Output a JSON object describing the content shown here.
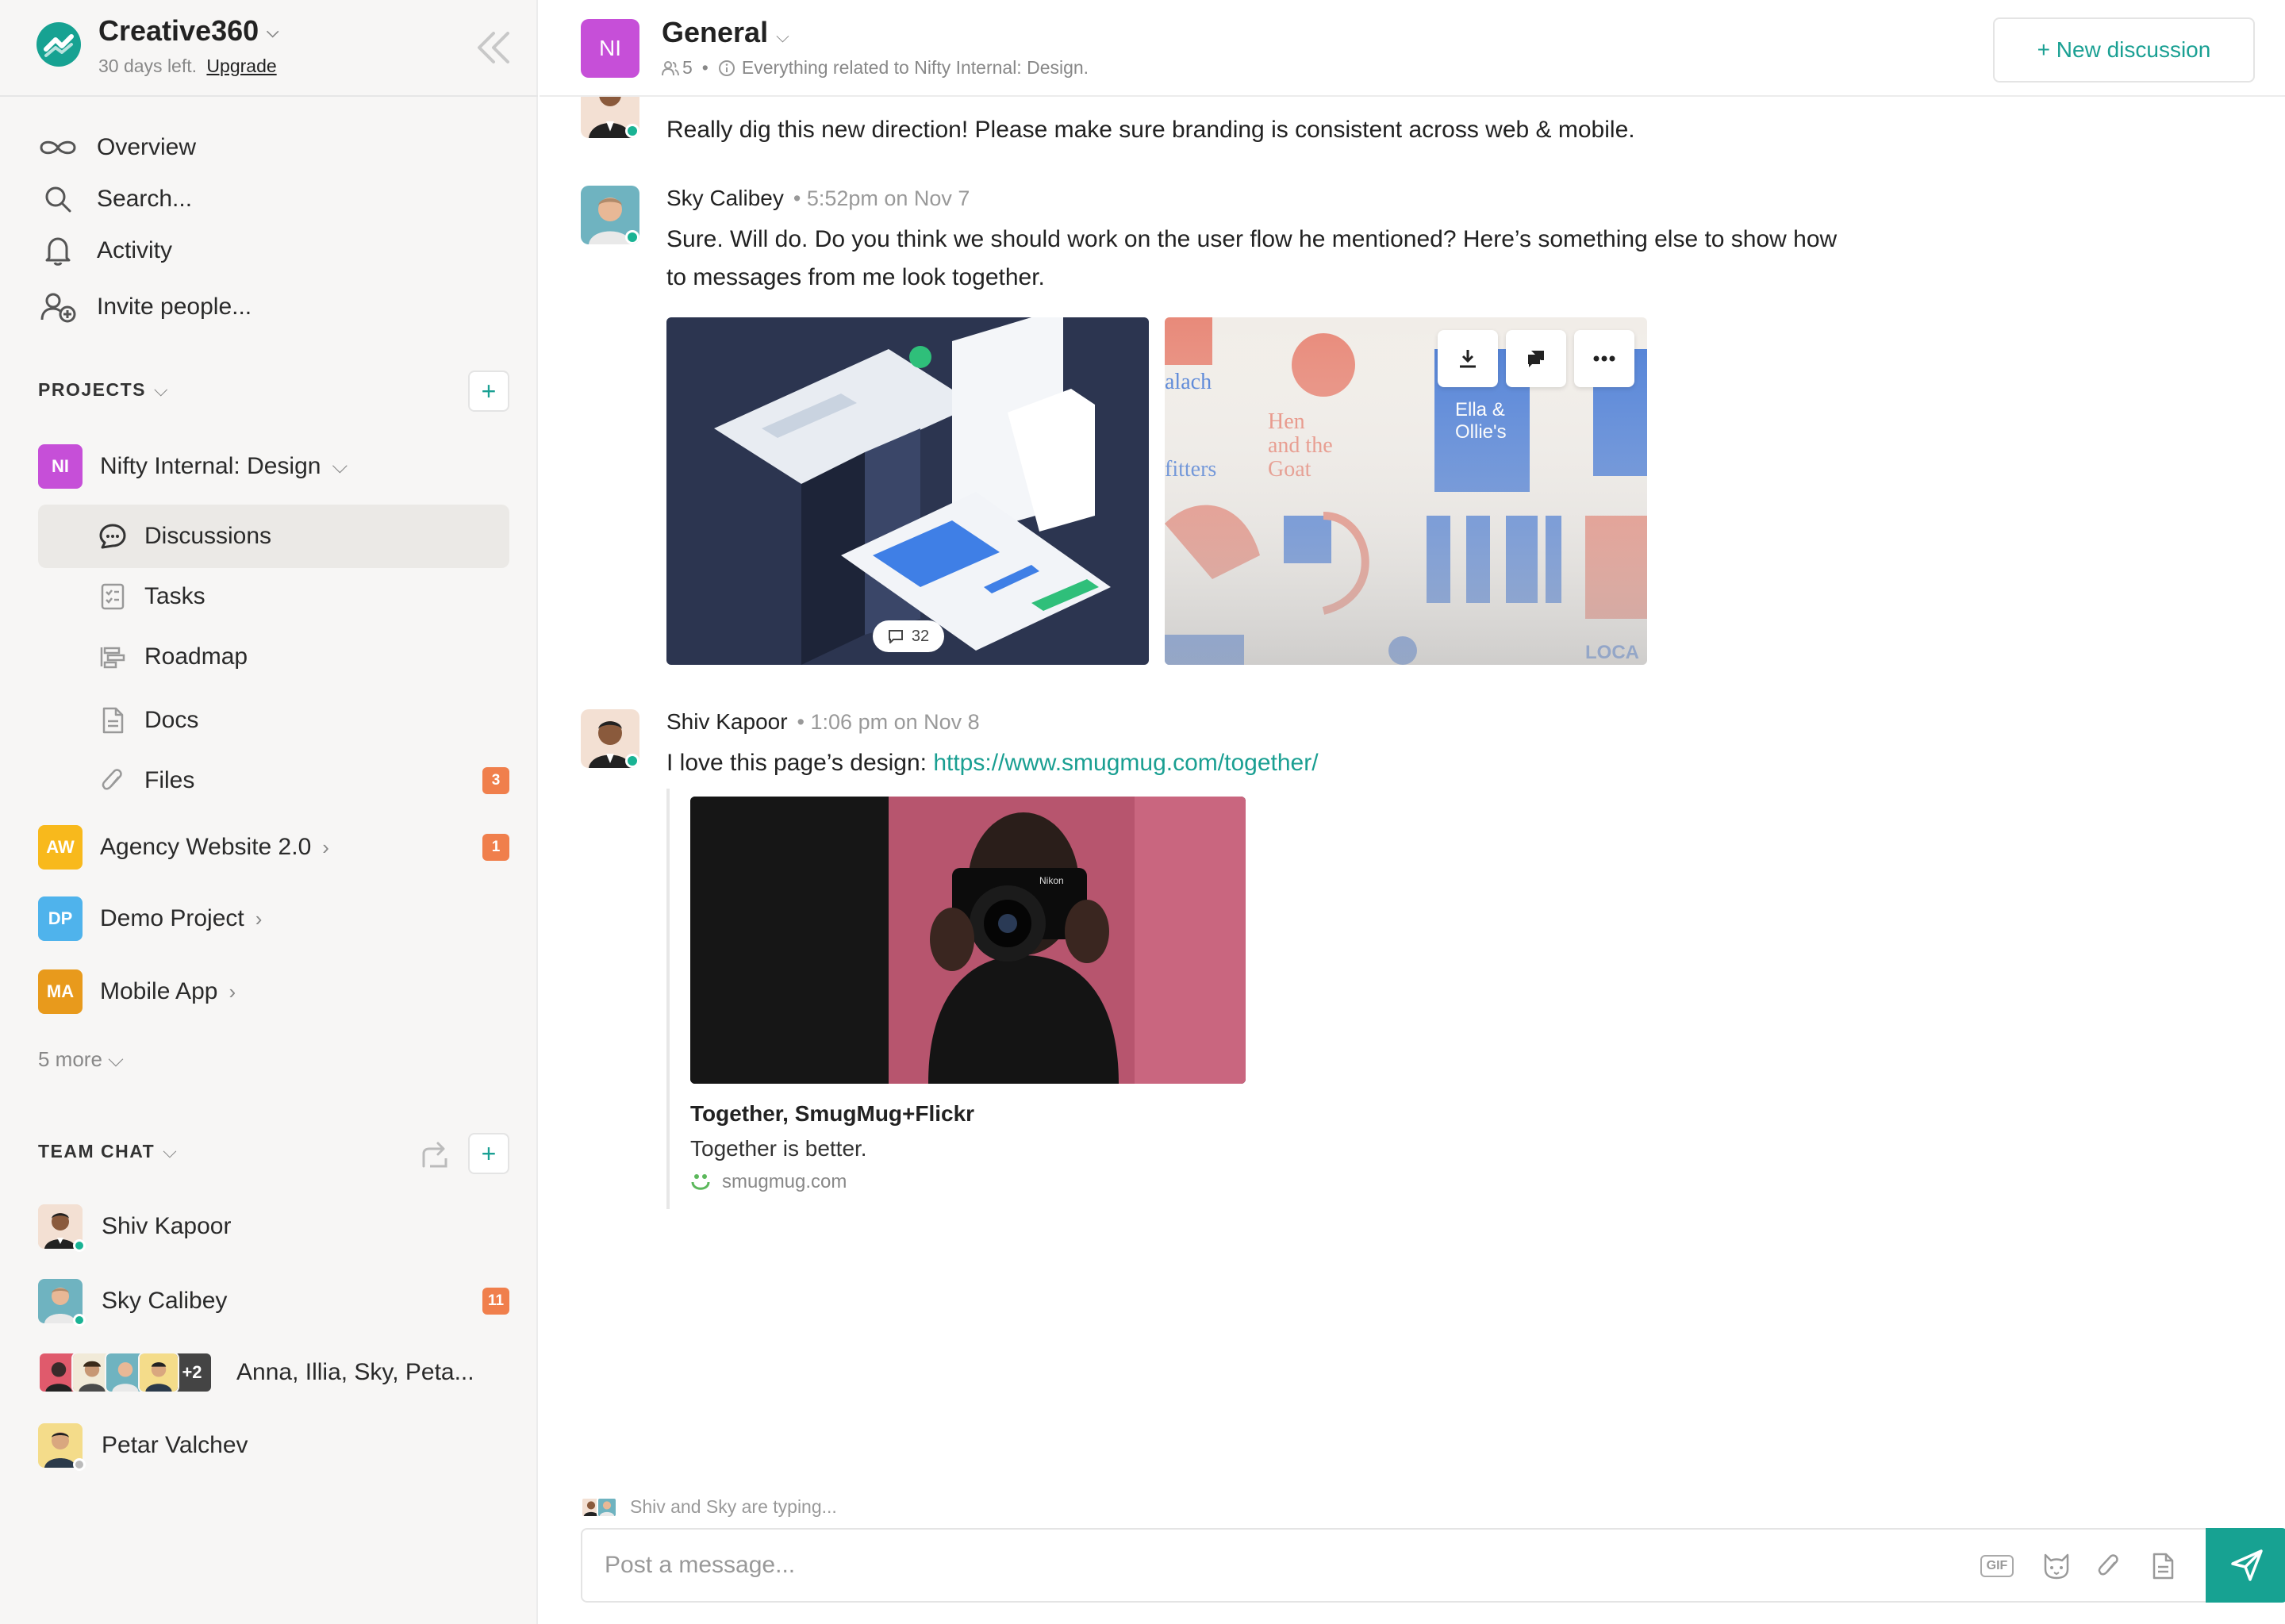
{
  "workspace": {
    "name": "Creative360",
    "trial_text": "30 days left.",
    "upgrade_label": "Upgrade"
  },
  "nav": {
    "overview": "Overview",
    "search": "Search...",
    "activity": "Activity",
    "invite": "Invite people..."
  },
  "projects": {
    "title": "PROJECTS",
    "items": [
      {
        "initials": "NI",
        "name": "Nifty Internal: Design",
        "color": "#c64fd8"
      },
      {
        "initials": "AW",
        "name": "Agency Website 2.0",
        "color": "#f8b91c",
        "count": "1"
      },
      {
        "initials": "DP",
        "name": "Demo Project",
        "color": "#4fb3ec"
      },
      {
        "initials": "MA",
        "name": "Mobile App",
        "color": "#e89a1c"
      }
    ],
    "sub_items": [
      {
        "label": "Discussions"
      },
      {
        "label": "Tasks"
      },
      {
        "label": "Roadmap"
      },
      {
        "label": "Docs"
      },
      {
        "label": "Files",
        "count": "3"
      }
    ],
    "more": "5 more"
  },
  "team_chat": {
    "title": "TEAM CHAT",
    "items": [
      {
        "name": "Shiv Kapoor"
      },
      {
        "name": "Sky Calibey",
        "count": "11"
      },
      {
        "name": "Anna, Illia, Sky, Peta...",
        "extra": "+2"
      },
      {
        "name": "Petar Valchev"
      }
    ]
  },
  "channel": {
    "initials": "NI",
    "title": "General",
    "members": "5",
    "description": "Everything related to Nifty Internal: Design.",
    "new_discussion": "+ New discussion"
  },
  "messages": [
    {
      "text": "Really dig this new direction! Please make sure branding is consistent across web & mobile."
    },
    {
      "author": "Sky Calibey",
      "time": "5:52pm on Nov 7",
      "text": "Sure. Will do. Do you think we should work on the user flow he mentioned? Here’s something else to show how to messages from me look together.",
      "comment_count": "32"
    },
    {
      "author": "Shiv Kapoor",
      "time": "1:06 pm on Nov 8",
      "text": "I love this page’s design: ",
      "link": "https://www.smugmug.com/together/",
      "preview": {
        "title": "Together, SmugMug+Flickr",
        "description": "Together is better.",
        "domain": "smugmug.com"
      }
    }
  ],
  "composer": {
    "typing": "Shiv and Sky are typing...",
    "placeholder": "Post a message...",
    "gif_label": "GIF"
  },
  "colors": {
    "accent": "#17a292",
    "badge_orange": "#f07f4c",
    "online": "#19b394"
  }
}
